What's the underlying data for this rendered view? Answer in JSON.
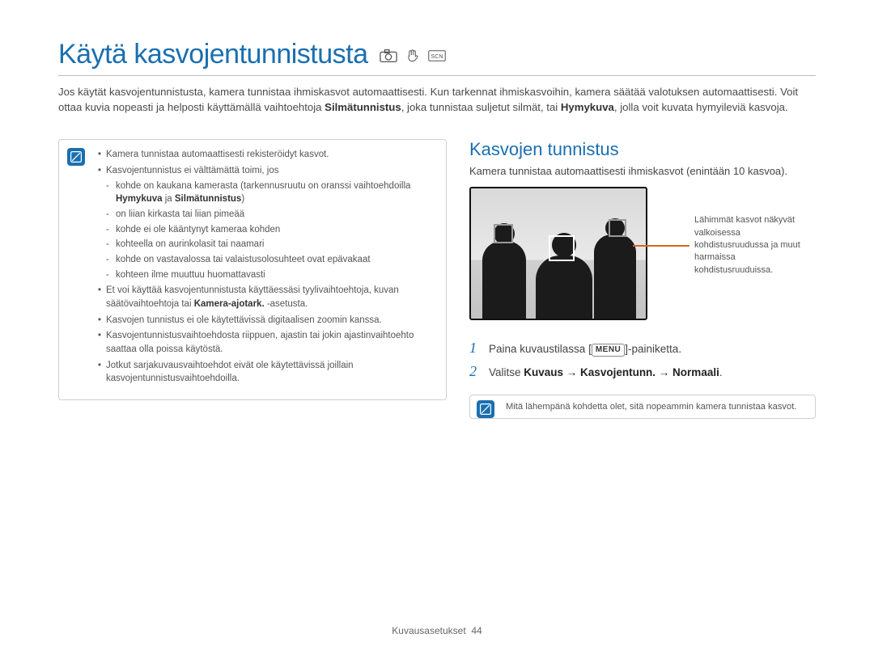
{
  "title": "Käytä kasvojentunnistusta",
  "title_icons": [
    "camera-mode-icon",
    "hand-mode-icon",
    "scene-mode-icon"
  ],
  "intro_parts": {
    "a": "Jos käytät kasvojentunnistusta, kamera tunnistaa ihmiskasvot automaattisesti. Kun tarkennat ihmiskasvoihin, kamera säätää valotuksen automaattisesti. Voit ottaa kuvia nopeasti ja helposti käyttämällä vaihtoehtoja ",
    "b1": "Silmätunnistus",
    "c": ", joka tunnistaa suljetut silmät, tai ",
    "b2": "Hymykuva",
    "d": ", jolla voit kuvata hymyileviä kasvoja."
  },
  "note": {
    "items": [
      {
        "text": "Kamera tunnistaa automaattisesti rekisteröidyt kasvot."
      },
      {
        "text": "Kasvojentunnistus ei välttämättä toimi, jos",
        "sub": [
          {
            "pre": "kohde on kaukana kamerasta (tarkennusruutu on oranssi vaihtoehdoilla ",
            "b1": "Hymykuva",
            "mid": " ja ",
            "b2": "Silmätunnistus",
            "post": ")"
          },
          {
            "pre": "on liian kirkasta tai liian pimeää"
          },
          {
            "pre": "kohde ei ole kääntynyt kameraa kohden"
          },
          {
            "pre": "kohteella on aurinkolasit tai naamari"
          },
          {
            "pre": "kohde on vastavalossa tai valaistusolosuhteet ovat epävakaat"
          },
          {
            "pre": "kohteen ilme muuttuu huomattavasti"
          }
        ]
      },
      {
        "text_pre": "Et voi käyttää kasvojentunnistusta käyttäessäsi tyylivaihtoehtoja, kuvan säätövaihtoehtoja tai ",
        "b": "Kamera-ajotark.",
        "text_post": " -asetusta."
      },
      {
        "text": "Kasvojen tunnistus ei ole käytettävissä digitaalisen zoomin kanssa."
      },
      {
        "text": "Kasvojentunnistusvaihtoehdosta riippuen, ajastin tai jokin ajastinvaihtoehto saattaa olla poissa käytöstä."
      },
      {
        "text": "Jotkut sarjakuvausvaihtoehdot eivät ole käytettävissä joillain kasvojentunnistusvaihtoehdoilla."
      }
    ]
  },
  "section": {
    "heading": "Kasvojen tunnistus",
    "sub": "Kamera tunnistaa automaattisesti ihmiskasvot (enintään 10 kasvoa).",
    "callout": "Lähimmät kasvot näkyvät valkoisessa kohdistusruudussa ja muut harmaissa kohdistusruuduissa."
  },
  "steps": [
    {
      "num": "1",
      "pre": "Paina kuvaustilassa [",
      "pill": "MENU",
      "post": "]-painiketta."
    },
    {
      "num": "2",
      "pre": "Valitse ",
      "bold": "Kuvaus → Kasvojentunn. → Normaali",
      "post": "."
    }
  ],
  "tip": "Mitä lähempänä kohdetta olet, sitä nopeammin kamera tunnistaa kasvot.",
  "footer": {
    "label": "Kuvausasetukset",
    "page": "44"
  }
}
